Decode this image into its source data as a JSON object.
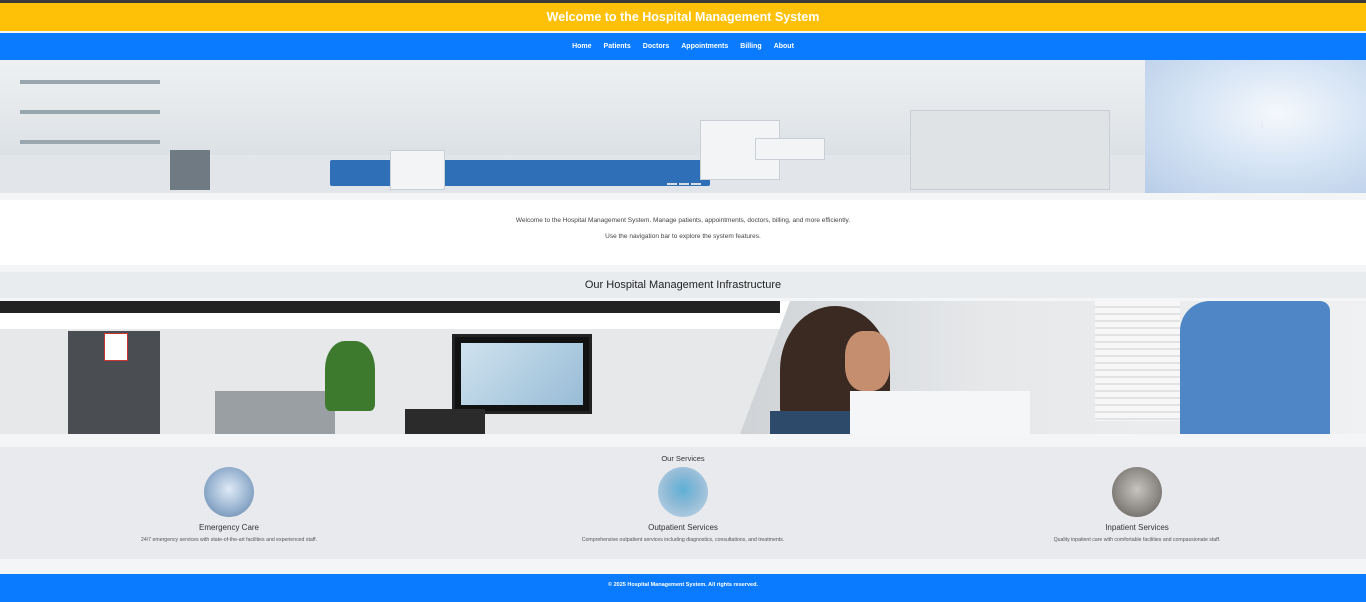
{
  "banner": {
    "title": "Welcome to the Hospital Management System"
  },
  "nav": {
    "items": [
      "Home",
      "Patients",
      "Doctors",
      "Appointments",
      "Billing",
      "About"
    ]
  },
  "intro": {
    "line1": "Welcome to the Hospital Management System. Manage patients, appointments, doctors, billing, and more efficiently.",
    "line2": "Use the navigation bar to explore the system features."
  },
  "infrastructure": {
    "title": "Our Hospital Management Infrastructure"
  },
  "services": {
    "title": "Our Services",
    "items": [
      {
        "name": "Emergency Care",
        "desc": "24/7 emergency services with state-of-the-art facilities and experienced staff."
      },
      {
        "name": "Outpatient Services",
        "desc": "Comprehensive outpatient services including diagnostics, consultations, and treatments."
      },
      {
        "name": "Inpatient Services",
        "desc": "Quality inpatient care with comfortable facilities and compassionate staff."
      }
    ]
  },
  "footer": {
    "text": "© 2025 Hospital Management System. All rights reserved."
  },
  "colors": {
    "banner": "#ffc107",
    "nav": "#0a7bff",
    "footer": "#0a7bff"
  }
}
